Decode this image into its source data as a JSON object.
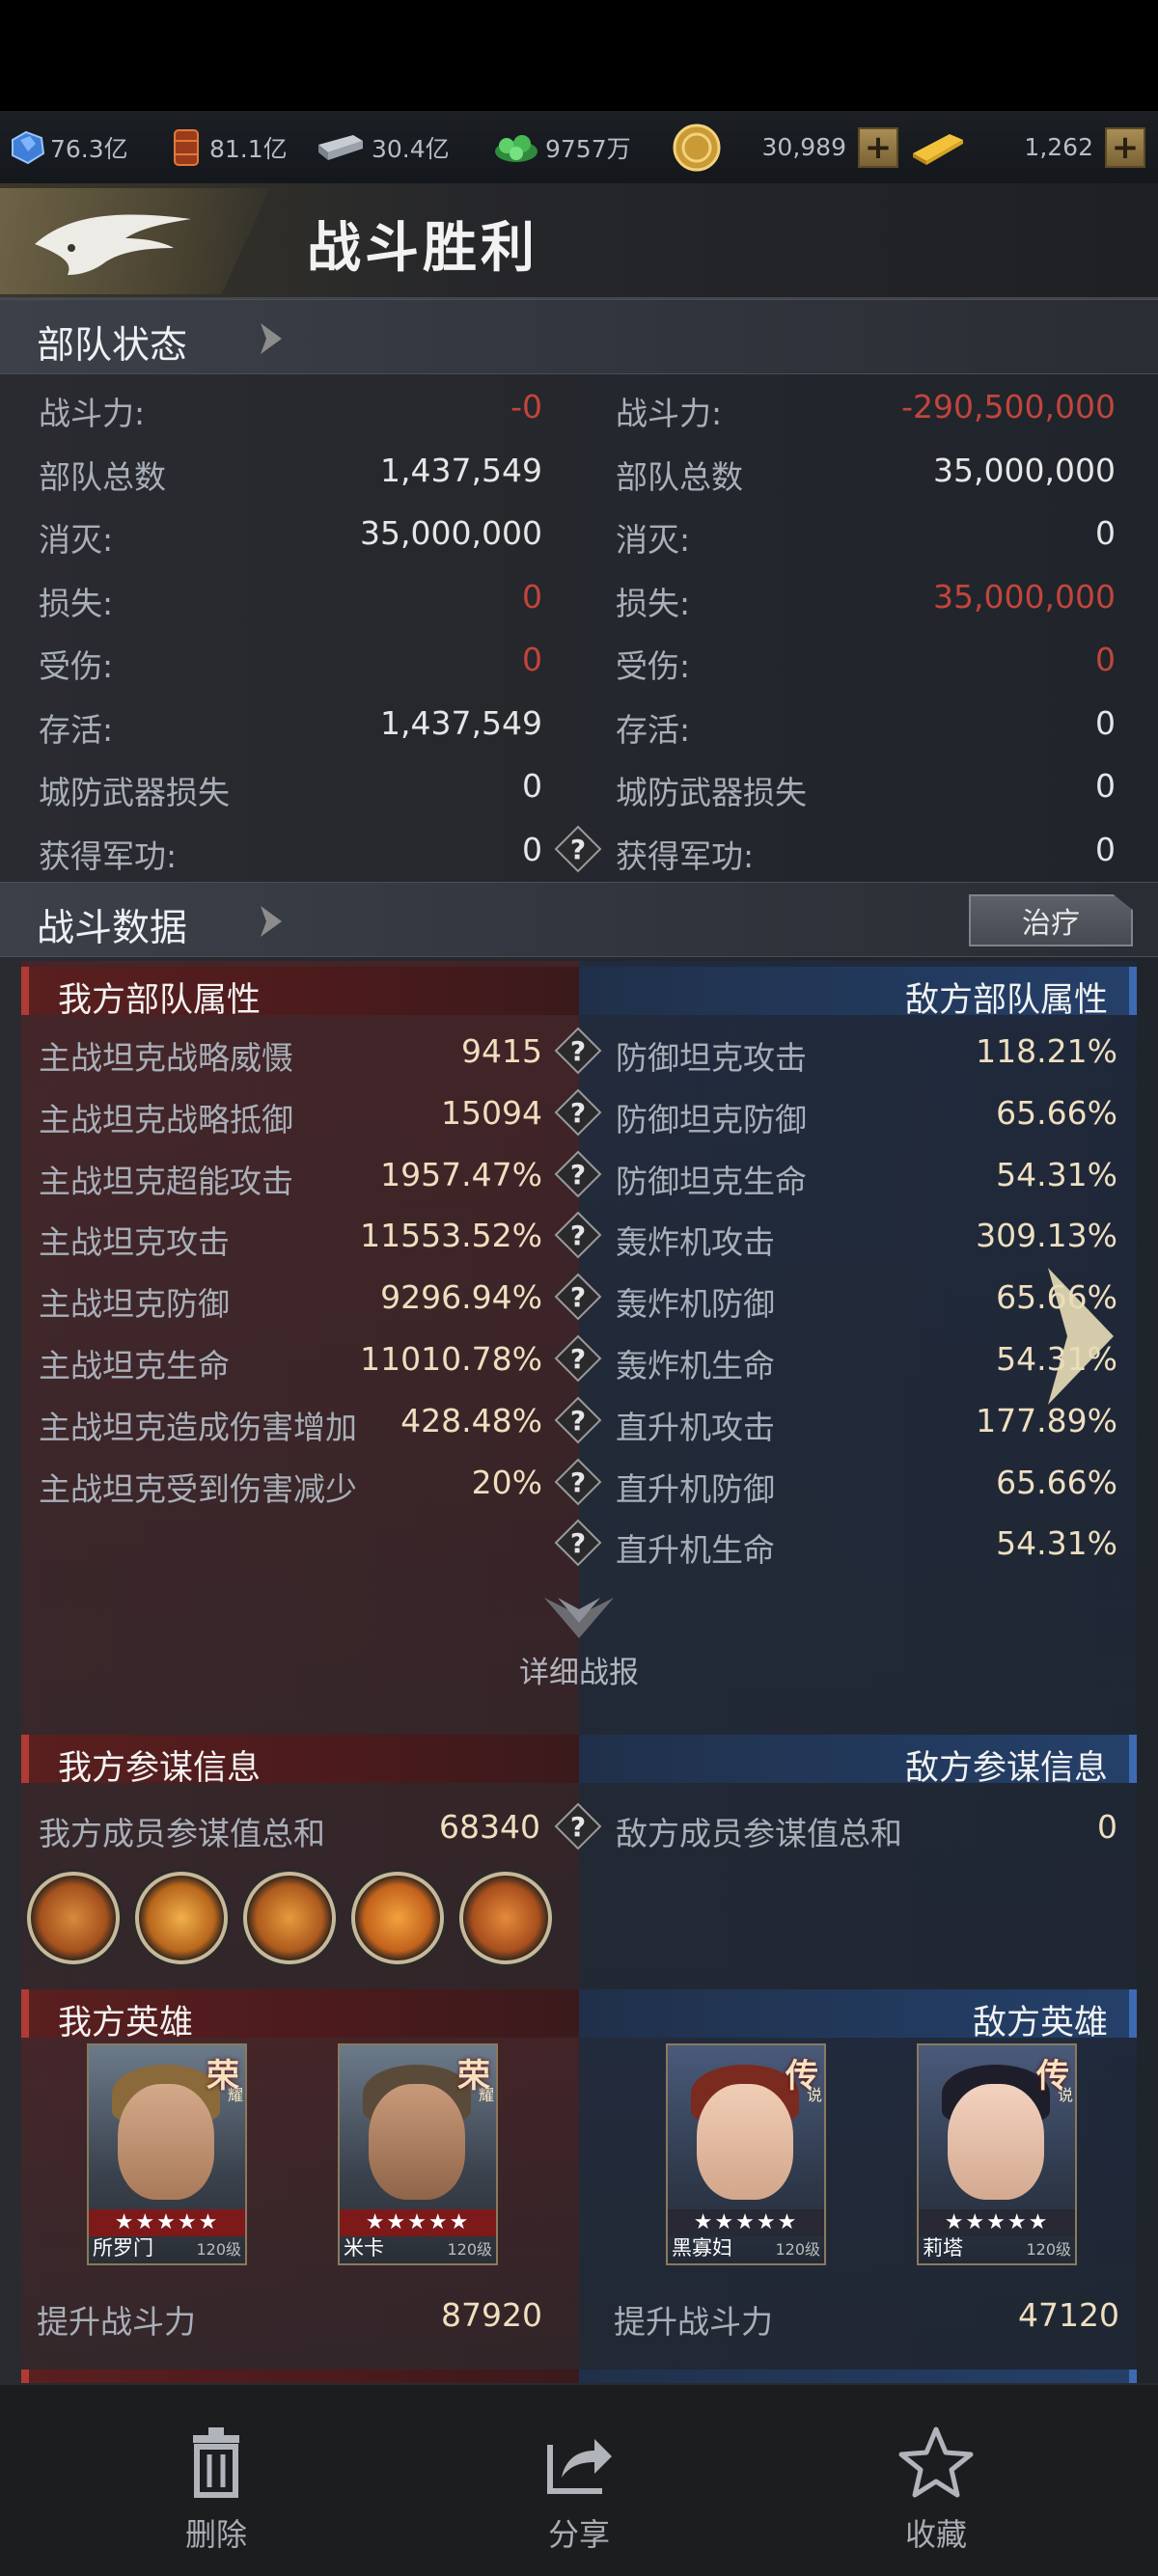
{
  "resources": [
    {
      "icon": "crystal-icon",
      "value": "76.3亿"
    },
    {
      "icon": "oil-barrel-icon",
      "value": "81.1亿"
    },
    {
      "icon": "steel-icon",
      "value": "30.4亿"
    },
    {
      "icon": "rare-earth-icon",
      "value": "9757万"
    },
    {
      "icon": "coin-icon",
      "value": "30,989"
    },
    {
      "icon": "gold-bar-icon",
      "value": "1,262"
    }
  ],
  "title": "战斗胜利",
  "troop_status": {
    "title": "部队状态",
    "left": [
      {
        "label": "战斗力:",
        "value": "-0",
        "color": "red"
      },
      {
        "label": "部队总数",
        "value": "1,437,549",
        "color": "normal"
      },
      {
        "label": "消灭:",
        "value": "35,000,000",
        "color": "normal"
      },
      {
        "label": "损失:",
        "value": "0",
        "color": "red"
      },
      {
        "label": "受伤:",
        "value": "0",
        "color": "red"
      },
      {
        "label": "存活:",
        "value": "1,437,549",
        "color": "normal"
      },
      {
        "label": "城防武器损失",
        "value": "0",
        "color": "normal"
      },
      {
        "label": "获得军功:",
        "value": "0",
        "color": "normal"
      }
    ],
    "right": [
      {
        "label": "战斗力:",
        "value": "-290,500,000",
        "color": "red"
      },
      {
        "label": "部队总数",
        "value": "35,000,000",
        "color": "normal"
      },
      {
        "label": "消灭:",
        "value": "0",
        "color": "normal"
      },
      {
        "label": "损失:",
        "value": "35,000,000",
        "color": "red"
      },
      {
        "label": "受伤:",
        "value": "0",
        "color": "red"
      },
      {
        "label": "存活:",
        "value": "0",
        "color": "normal"
      },
      {
        "label": "城防武器损失",
        "value": "0",
        "color": "normal"
      },
      {
        "label": "获得军功:",
        "value": "0",
        "color": "normal"
      }
    ]
  },
  "battle_data": {
    "title": "战斗数据",
    "heal_button": "治疗",
    "left_header": "我方部队属性",
    "right_header": "敌方部队属性",
    "left": [
      {
        "label": "主战坦克战略威慑",
        "value": "9415"
      },
      {
        "label": "主战坦克战略抵御",
        "value": "15094"
      },
      {
        "label": "主战坦克超能攻击",
        "value": "1957.47%"
      },
      {
        "label": "主战坦克攻击",
        "value": "11553.52%"
      },
      {
        "label": "主战坦克防御",
        "value": "9296.94%"
      },
      {
        "label": "主战坦克生命",
        "value": "11010.78%"
      },
      {
        "label": "主战坦克造成伤害增加",
        "value": "428.48%"
      },
      {
        "label": "主战坦克受到伤害减少",
        "value": "20%"
      }
    ],
    "right": [
      {
        "label": "防御坦克攻击",
        "value": "118.21%"
      },
      {
        "label": "防御坦克防御",
        "value": "65.66%"
      },
      {
        "label": "防御坦克生命",
        "value": "54.31%"
      },
      {
        "label": "轰炸机攻击",
        "value": "309.13%"
      },
      {
        "label": "轰炸机防御",
        "value": "65.66%"
      },
      {
        "label": "轰炸机生命",
        "value": "54.31%"
      },
      {
        "label": "直升机攻击",
        "value": "177.89%"
      },
      {
        "label": "直升机防御",
        "value": "65.66%"
      },
      {
        "label": "直升机生命",
        "value": "54.31%"
      }
    ],
    "detail_label": "详细战报"
  },
  "advisor": {
    "left_header": "我方参谋信息",
    "right_header": "敌方参谋信息",
    "left_label": "我方成员参谋值总和",
    "left_value": "68340",
    "right_label": "敌方成员参谋值总和",
    "right_value": "0"
  },
  "heroes": {
    "left_header": "我方英雄",
    "right_header": "敌方英雄",
    "left": [
      {
        "name": "所罗门",
        "level": "120级",
        "rank": "荣",
        "rank_sub": "耀",
        "stars": "★★★★★"
      },
      {
        "name": "米卡",
        "level": "120级",
        "rank": "荣",
        "rank_sub": "耀",
        "stars": "★★★★★"
      }
    ],
    "right": [
      {
        "name": "黑寡妇",
        "level": "120级",
        "rank": "传",
        "rank_sub": "说",
        "stars": "★★★★★"
      },
      {
        "name": "莉塔",
        "level": "120级",
        "rank": "传",
        "rank_sub": "说",
        "stars": "★★★★★"
      }
    ],
    "left_boost_label": "提升战斗力",
    "left_boost_value": "87920",
    "right_boost_label": "提升战斗力",
    "right_boost_value": "47120"
  },
  "bottom_nav": [
    {
      "label": "删除",
      "icon": "trash-icon"
    },
    {
      "label": "分享",
      "icon": "share-icon"
    },
    {
      "label": "收藏",
      "icon": "star-icon"
    }
  ]
}
